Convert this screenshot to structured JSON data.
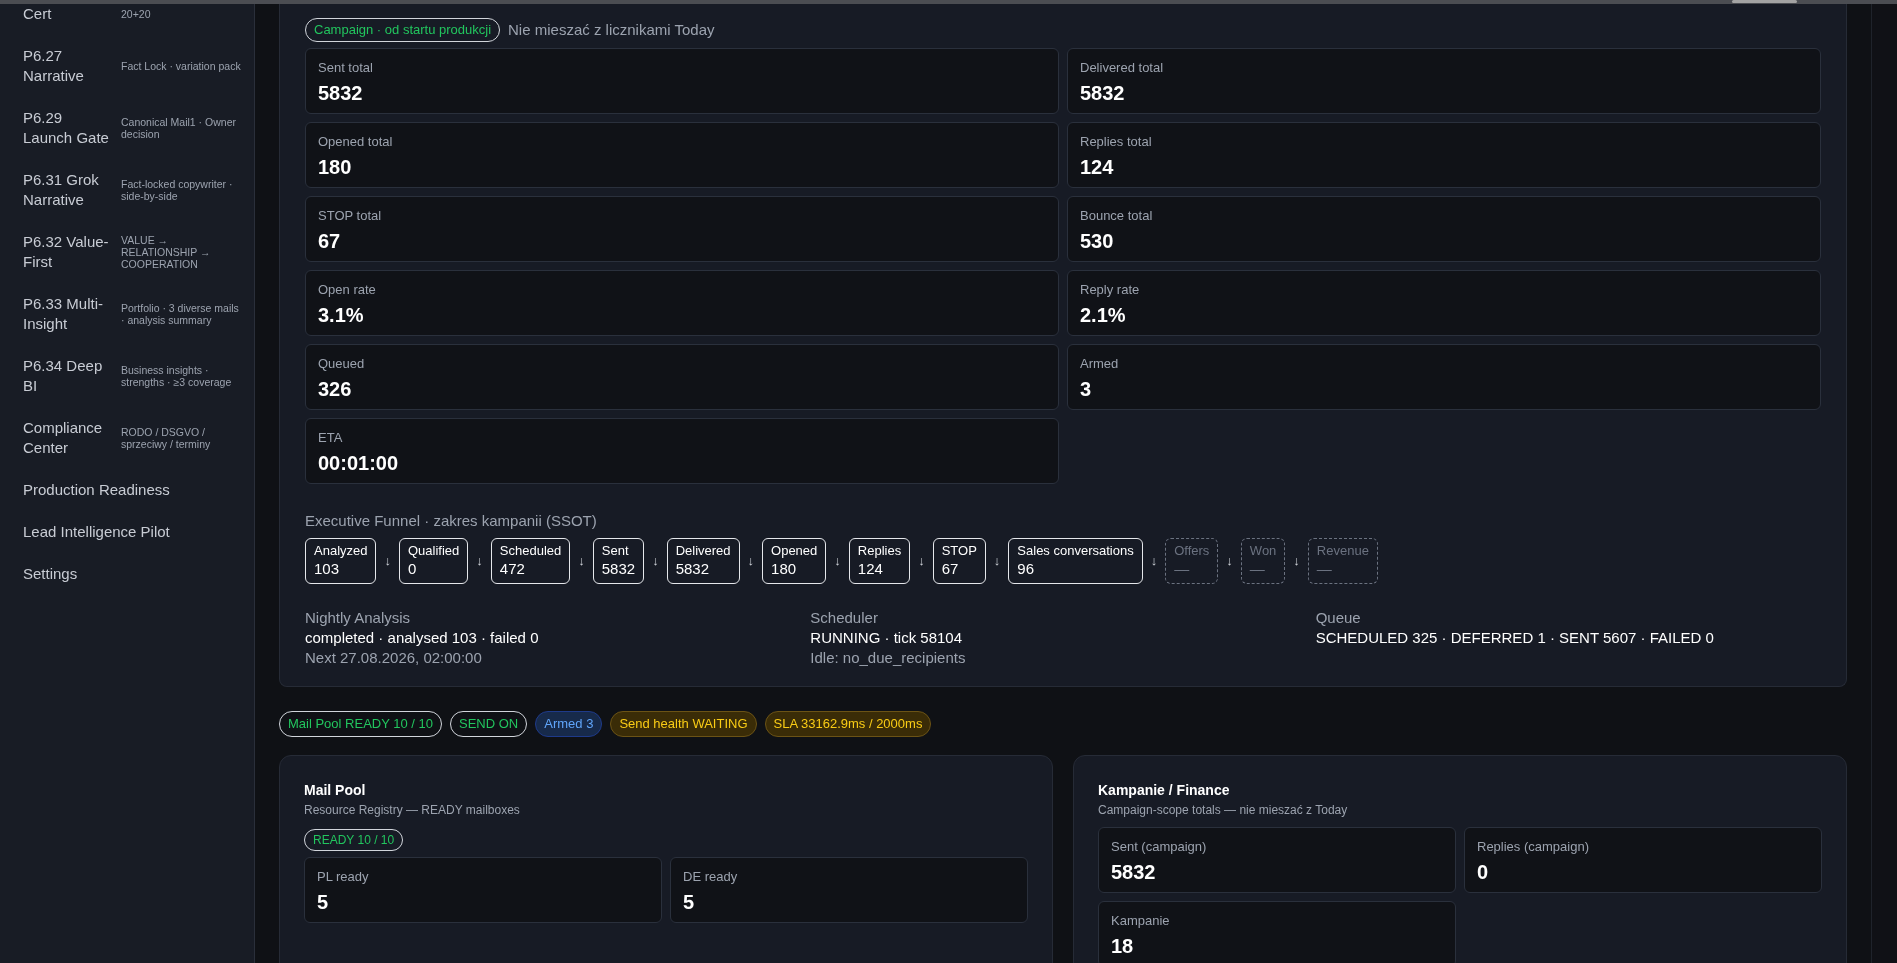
{
  "sidebar": {
    "items": [
      {
        "title": "Cert",
        "subtitle": "20+20"
      },
      {
        "title": "P6.27 Narrative",
        "subtitle": "Fact Lock · variation pack"
      },
      {
        "title": "P6.29 Launch Gate",
        "subtitle": "Canonical Mail1 · Owner decision"
      },
      {
        "title": "P6.31 Grok Narrative",
        "subtitle": "Fact-locked copywriter · side-by-side"
      },
      {
        "title": "P6.32 Value-First",
        "subtitle": "VALUE → RELATIONSHIP → COOPERATION"
      },
      {
        "title": "P6.33 Multi-Insight",
        "subtitle": "Portfolio · 3 diverse mails · analysis summary"
      },
      {
        "title": "P6.34 Deep BI",
        "subtitle": "Business insights · strengths · ≥3 coverage"
      },
      {
        "title": "Compliance Center",
        "subtitle": "RODO / DSGVO / sprzeciwy / terminy"
      },
      {
        "title": "Production Readiness"
      },
      {
        "title": "Lead Intelligence Pilot"
      },
      {
        "title": "Settings"
      }
    ]
  },
  "campaign": {
    "badge": "Campaign · od startu produkcji",
    "note": "Nie mieszać z licznikami Today",
    "metrics": [
      {
        "label": "Sent total",
        "value": "5832"
      },
      {
        "label": "Delivered total",
        "value": "5832"
      },
      {
        "label": "Opened total",
        "value": "180"
      },
      {
        "label": "Replies total",
        "value": "124"
      },
      {
        "label": "STOP total",
        "value": "67"
      },
      {
        "label": "Bounce total",
        "value": "530"
      },
      {
        "label": "Open rate",
        "value": "3.1%"
      },
      {
        "label": "Reply rate",
        "value": "2.1%"
      },
      {
        "label": "Queued",
        "value": "326"
      },
      {
        "label": "Armed",
        "value": "3"
      },
      {
        "label": "ETA",
        "value": "00:01:00"
      }
    ],
    "funnel": {
      "title": "Executive Funnel · zakres kampanii (SSOT)",
      "arrow": "↓",
      "steps": [
        {
          "label": "Analyzed",
          "value": "103",
          "pending": false
        },
        {
          "label": "Qualified",
          "value": "0",
          "pending": false
        },
        {
          "label": "Scheduled",
          "value": "472",
          "pending": false
        },
        {
          "label": "Sent",
          "value": "5832",
          "pending": false
        },
        {
          "label": "Delivered",
          "value": "5832",
          "pending": false
        },
        {
          "label": "Opened",
          "value": "180",
          "pending": false
        },
        {
          "label": "Replies",
          "value": "124",
          "pending": false
        },
        {
          "label": "STOP",
          "value": "67",
          "pending": false
        },
        {
          "label": "Sales conversations",
          "value": "96",
          "pending": false
        },
        {
          "label": "Offers",
          "value": "—",
          "pending": true
        },
        {
          "label": "Won",
          "value": "—",
          "pending": true
        },
        {
          "label": "Revenue",
          "value": "—",
          "pending": true
        }
      ]
    },
    "status": [
      {
        "title": "Nightly Analysis",
        "main": "completed · analysed 103 · failed 0",
        "detail": "Next 27.08.2026, 02:00:00"
      },
      {
        "title": "Scheduler",
        "main": "RUNNING · tick 58104",
        "detail": "Idle: no_due_recipients"
      },
      {
        "title": "Queue",
        "main": "SCHEDULED 325 · DEFERRED 1 · SENT 5607 · FAILED 0"
      }
    ]
  },
  "badges": [
    {
      "text": "Mail Pool READY 10 / 10",
      "kind": "green"
    },
    {
      "text": "SEND ON",
      "kind": "green"
    },
    {
      "text": "Armed 3",
      "kind": "blue"
    },
    {
      "text": "Send health WAITING",
      "kind": "yellow"
    },
    {
      "text": "SLA 33162.9ms / 2000ms",
      "kind": "yellow"
    }
  ],
  "mail_pool": {
    "title": "Mail Pool",
    "subtitle": "Resource Registry — READY mailboxes",
    "badge": "READY 10 / 10",
    "metrics": [
      {
        "label": "PL ready",
        "value": "5"
      },
      {
        "label": "DE ready",
        "value": "5"
      }
    ]
  },
  "finance": {
    "title": "Kampanie / Finance",
    "subtitle": "Campaign-scope totals — nie mieszać z Today",
    "metrics": [
      {
        "label": "Sent (campaign)",
        "value": "5832"
      },
      {
        "label": "Replies (campaign)",
        "value": "0"
      },
      {
        "label": "Kampanie",
        "value": "18"
      }
    ]
  }
}
